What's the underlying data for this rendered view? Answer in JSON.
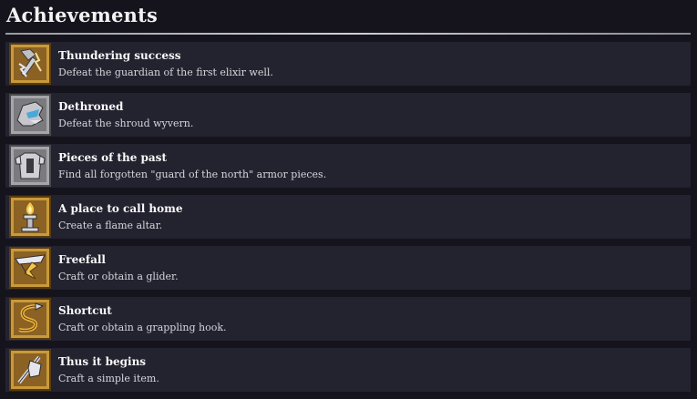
{
  "header": {
    "title": "Achievements"
  },
  "colors": {
    "frame_gold": "#c89a3a",
    "frame_dark": "#6b4a16",
    "row_bg": "#23222f",
    "page_bg": "#15141d",
    "active_icon_bg": "#8b6224",
    "grey_icon_bg": "#7b7a7e"
  },
  "achievements": [
    {
      "name": "Thundering success",
      "description": "Defeat the guardian of the first elixir well.",
      "icon": "lightning-hammer-icon"
    },
    {
      "name": "Dethroned",
      "description": "Defeat the shroud wyvern.",
      "icon": "wyvern-head-icon"
    },
    {
      "name": "Pieces of the past",
      "description": "Find all forgotten \"guard of the north\" armor pieces.",
      "icon": "armor-chestplate-icon"
    },
    {
      "name": "A place to call home",
      "description": "Create a flame altar.",
      "icon": "flame-altar-icon"
    },
    {
      "name": "Freefall",
      "description": "Craft or obtain a glider.",
      "icon": "glider-icon"
    },
    {
      "name": "Shortcut",
      "description": "Craft or obtain a grappling hook.",
      "icon": "grappling-hook-icon"
    },
    {
      "name": "Thus it begins",
      "description": "Craft a simple item.",
      "icon": "stone-axe-icon"
    }
  ]
}
